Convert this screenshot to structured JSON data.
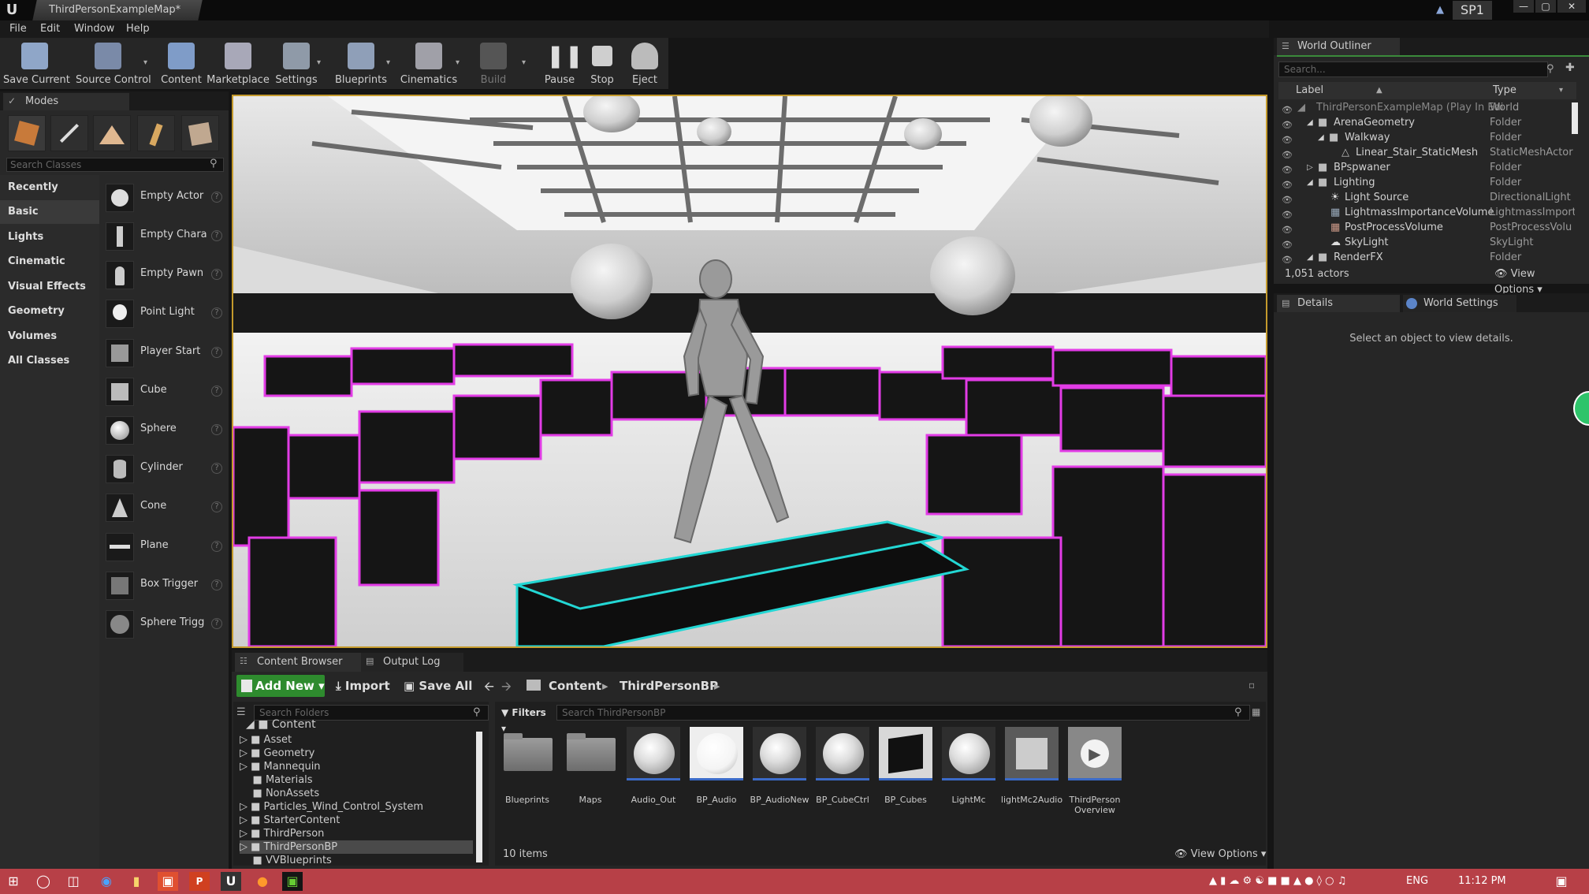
{
  "window": {
    "logo": "U",
    "doc_tab": "ThirdPersonExampleMap*",
    "project_badge": "SP1",
    "controls": [
      "—",
      "▢",
      "✕"
    ]
  },
  "menu": [
    "File",
    "Edit",
    "Window",
    "Help"
  ],
  "toolbar": [
    {
      "label": "Save Current",
      "icon": "save-icon",
      "color": "#8fa6c8"
    },
    {
      "label": "Source Control",
      "icon": "source-control-icon",
      "color": "#7a8aa8"
    },
    {
      "label": "Content",
      "icon": "content-icon",
      "color": "#7f9cc8"
    },
    {
      "label": "Marketplace",
      "icon": "marketplace-icon",
      "color": "#a8a8b8"
    },
    {
      "label": "Settings",
      "icon": "settings-icon",
      "color": "#8f9aa8"
    },
    {
      "label": "Blueprints",
      "icon": "blueprints-icon",
      "color": "#8f9fb8"
    },
    {
      "label": "Cinematics",
      "icon": "cinematics-icon",
      "color": "#a0a0a8"
    },
    {
      "label": "Build",
      "icon": "build-icon",
      "color": "#555555"
    },
    {
      "label": "Pause",
      "icon": "pause-icon",
      "color": "#cfcfcf"
    },
    {
      "label": "Stop",
      "icon": "stop-icon",
      "color": "#cfcfcf"
    },
    {
      "label": "Eject",
      "icon": "eject-icon",
      "color": "#cfcfcf"
    }
  ],
  "modes": {
    "tab_label": "Modes",
    "search_placeholder": "Search Classes",
    "categories": [
      "Recently Placed",
      "Basic",
      "Lights",
      "Cinematic",
      "Visual Effects",
      "Geometry",
      "Volumes",
      "All Classes"
    ],
    "selected_category": "Basic",
    "items": [
      "Empty Actor",
      "Empty Chara",
      "Empty Pawn",
      "Point Light",
      "Player Start",
      "Cube",
      "Sphere",
      "Cylinder",
      "Cone",
      "Plane",
      "Box Trigger",
      "Sphere Trigg"
    ]
  },
  "content_browser": {
    "tabs": [
      "Content Browser",
      "Output Log"
    ],
    "add_new": "Add New",
    "import": "Import",
    "save_all": "Save All",
    "breadcrumb": [
      "Content",
      "ThirdPersonBP"
    ],
    "search_folders_placeholder": "Search Folders",
    "filters": "Filters",
    "search_assets_placeholder": "Search ThirdPersonBP",
    "folder_root": "Content",
    "folders": [
      "Asset",
      "Geometry",
      "Mannequin",
      "Materials",
      "NonAssets",
      "Particles_Wind_Control_System",
      "StarterContent",
      "ThirdPerson",
      "ThirdPersonBP",
      "VVBlueprints"
    ],
    "selected_folder": "ThirdPersonBP",
    "assets": [
      "Blueprints",
      "Maps",
      "Audio_Out",
      "BP_Audio",
      "BP_AudioNew",
      "BP_CubeCtrl",
      "BP_Cubes",
      "LightMc",
      "lightMc2Audio",
      "ThirdPerson Overview"
    ],
    "item_count": "10 items",
    "view_options": "View Options"
  },
  "outliner": {
    "tab_label": "World Outliner",
    "search_placeholder": "Search...",
    "col_label": "Label",
    "col_type": "Type",
    "rows": [
      {
        "label": "ThirdPersonExampleMap (Play In Edi",
        "type": "World"
      },
      {
        "label": "ArenaGeometry",
        "type": "Folder"
      },
      {
        "label": "Walkway",
        "type": "Folder"
      },
      {
        "label": "Linear_Stair_StaticMesh",
        "type": "StaticMeshActor"
      },
      {
        "label": "BPspwaner",
        "type": "Folder"
      },
      {
        "label": "Lighting",
        "type": "Folder"
      },
      {
        "label": "Light Source",
        "type": "DirectionalLight"
      },
      {
        "label": "LightmassImportanceVolume",
        "type": "LightmassImporta"
      },
      {
        "label": "PostProcessVolume",
        "type": "PostProcessVolu"
      },
      {
        "label": "SkyLight",
        "type": "SkyLight"
      },
      {
        "label": "RenderFX",
        "type": "Folder"
      }
    ],
    "actor_count": "1,051 actors",
    "view_options": "View Options"
  },
  "details": {
    "tabs": [
      "Details",
      "World Settings"
    ],
    "empty_message": "Select an object to view details."
  },
  "taskbar": {
    "lang": "ENG",
    "time": "11:12 PM"
  }
}
